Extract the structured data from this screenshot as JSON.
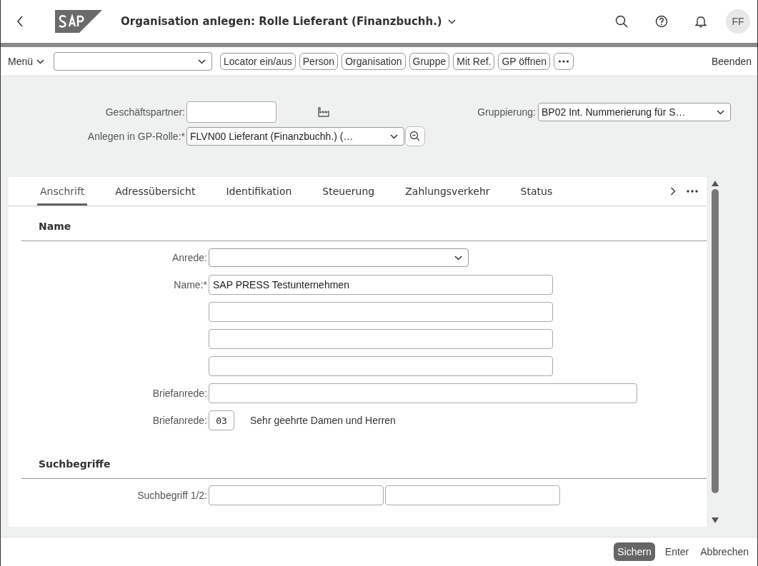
{
  "header": {
    "title": "Organisation anlegen: Rolle Lieferant (Finanzbuchh.)",
    "avatar": "FF"
  },
  "toolbar": {
    "menu": "Menü",
    "buttons": [
      "Locator ein/aus",
      "Person",
      "Organisation",
      "Gruppe",
      "Mit Ref.",
      "GP öffnen"
    ],
    "exit": "Beenden"
  },
  "top_fields": {
    "partner": {
      "label": "Geschäftspartner:"
    },
    "grouping": {
      "label": "Gruppierung:",
      "value": "BP02 Int. Nummerierung für S…"
    },
    "role": {
      "label": "Anlegen in GP-Rolle:*",
      "value": "FLVN00 Lieferant (Finanzbuchh.) (…"
    }
  },
  "tabs": [
    {
      "label": "Anschrift",
      "selected": true
    },
    {
      "label": "Adressübersicht",
      "selected": false
    },
    {
      "label": "Identifikation",
      "selected": false
    },
    {
      "label": "Steuerung",
      "selected": false
    },
    {
      "label": "Zahlungsverkehr",
      "selected": false
    },
    {
      "label": "Status",
      "selected": false
    }
  ],
  "sections": [
    {
      "title": "Name",
      "rows": [
        {
          "kind": "select",
          "label": "Anrede:"
        },
        {
          "kind": "text",
          "label": "Name:*",
          "value": "SAP PRESS Testunternehmen"
        },
        {
          "kind": "text"
        },
        {
          "kind": "text"
        },
        {
          "kind": "text"
        },
        {
          "kind": "wide",
          "label": "Briefanrede:"
        },
        {
          "kind": "code",
          "label": "Briefanrede:",
          "value": "03",
          "description": "Sehr geehrte Damen und Herren"
        }
      ]
    },
    {
      "title": "Suchbegriffe",
      "rows": [
        {
          "kind": "pair",
          "label": "Suchbegriff 1/2:"
        }
      ]
    }
  ],
  "footer": {
    "buttons": [
      {
        "label": "Sichern",
        "kind": "primary"
      },
      {
        "label": "Enter",
        "kind": "plain"
      },
      {
        "label": "Abbrechen",
        "kind": "plain"
      }
    ]
  }
}
